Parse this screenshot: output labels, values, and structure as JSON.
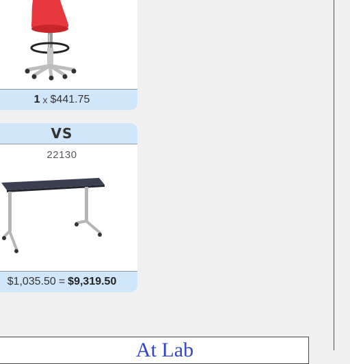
{
  "product1": {
    "quantity": "1",
    "times_sign": "x",
    "unit_price": "$441.75",
    "image_icon": "red-stool-image"
  },
  "comparison": {
    "vs_label": "VS"
  },
  "product2": {
    "sku": "22130",
    "unit_price": "$1,035.50",
    "equals_sign": "=",
    "total_price": "$9,319.50",
    "image_icon": "dark-table-image"
  },
  "footer": {
    "banner_text": "At Lab"
  },
  "colors": {
    "price_bar_bg": "#cfe6fb",
    "page_bg": "#f0f0f0",
    "banner_text": "#3344cc",
    "stool_seat": "#e8383d"
  }
}
